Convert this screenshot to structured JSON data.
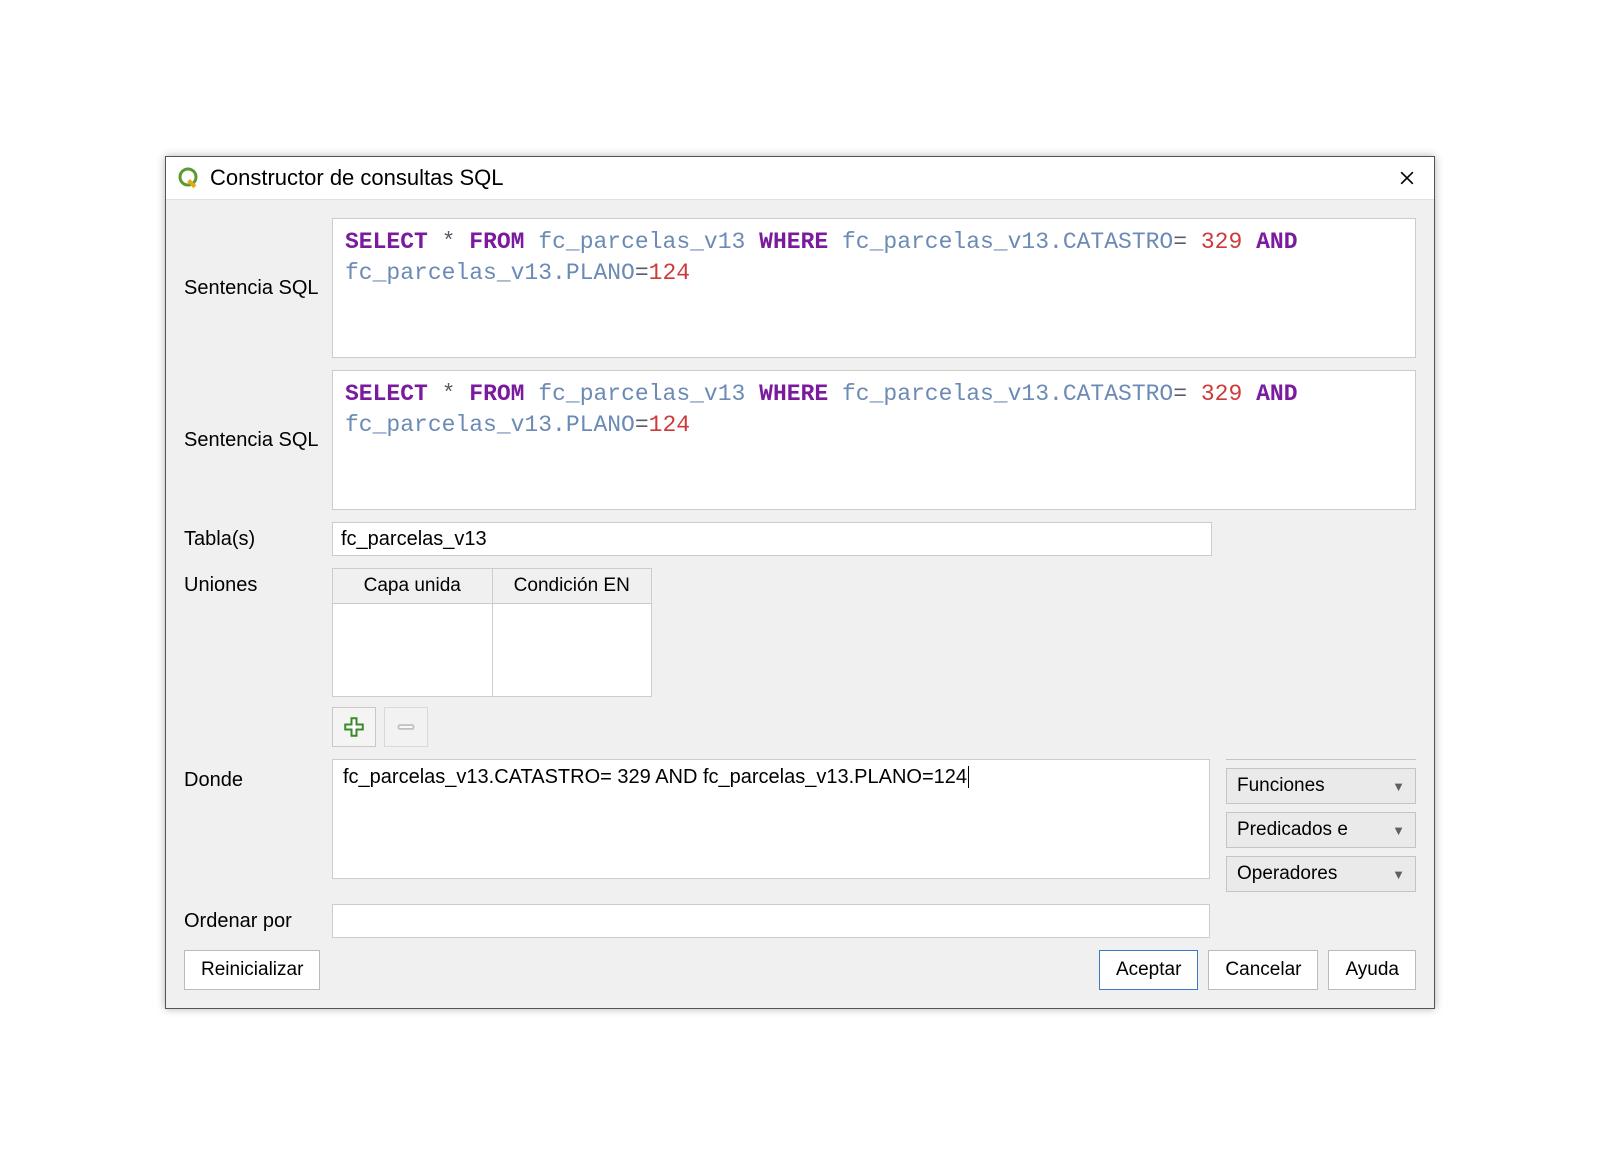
{
  "title": "Constructor de consultas SQL",
  "labels": {
    "sentencia_sql_1": "Sentencia SQL",
    "sentencia_sql_2": "Sentencia SQL",
    "tables": "Tabla(s)",
    "joins": "Uniones",
    "where": "Donde",
    "order_by": "Ordenar por"
  },
  "sql": {
    "tokens": [
      {
        "t": "kw",
        "v": "SELECT"
      },
      {
        "t": "sp",
        "v": " "
      },
      {
        "t": "op",
        "v": "*"
      },
      {
        "t": "sp",
        "v": " "
      },
      {
        "t": "kw",
        "v": "FROM"
      },
      {
        "t": "sp",
        "v": " "
      },
      {
        "t": "tbl",
        "v": "fc_parcelas_v13"
      },
      {
        "t": "sp",
        "v": " "
      },
      {
        "t": "kw",
        "v": "WHERE"
      },
      {
        "t": "sp",
        "v": " "
      },
      {
        "t": "tbl",
        "v": "fc_parcelas_v13.CATASTRO"
      },
      {
        "t": "op",
        "v": "="
      },
      {
        "t": "sp",
        "v": " "
      },
      {
        "t": "lit",
        "v": "329"
      },
      {
        "t": "sp",
        "v": " "
      },
      {
        "t": "kw",
        "v": "AND"
      },
      {
        "t": "sp",
        "v": " "
      },
      {
        "t": "tbl",
        "v": "fc_parcelas_v13.PLANO"
      },
      {
        "t": "op",
        "v": "="
      },
      {
        "t": "lit",
        "v": "124"
      }
    ]
  },
  "tables_value": "fc_parcelas_v13",
  "joins_headers": [
    "Capa unida",
    "Condición EN"
  ],
  "where_value": "fc_parcelas_v13.CATASTRO= 329 AND fc_parcelas_v13.PLANO=124",
  "order_by_value": "",
  "dropdowns": {
    "functions": "Funciones",
    "predicates": "Predicados e",
    "operators": "Operadores"
  },
  "buttons": {
    "reset": "Reinicializar",
    "accept": "Aceptar",
    "cancel": "Cancelar",
    "help": "Ayuda"
  }
}
